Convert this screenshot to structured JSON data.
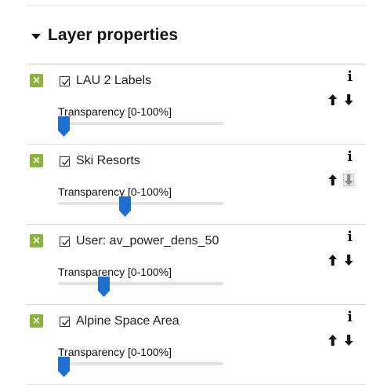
{
  "panel": {
    "title": "Layer properties",
    "collapse_icon": "caret-down-icon"
  },
  "layers": [
    {
      "name": "LAU 2 Labels",
      "visible": true,
      "transparency_label": "Transparency [0-100%]",
      "transparency": 0,
      "move_down_disabled": false
    },
    {
      "name": "Ski Resorts",
      "visible": true,
      "transparency_label": "Transparency [0-100%]",
      "transparency": 40,
      "move_down_disabled": true
    },
    {
      "name": "User: av_power_dens_50",
      "visible": true,
      "transparency_label": "Transparency [0-100%]",
      "transparency": 26,
      "move_down_disabled": false
    },
    {
      "name": "Alpine Space Area",
      "visible": true,
      "transparency_label": "Transparency [0-100%]",
      "transparency": 0,
      "move_down_disabled": false
    }
  ],
  "icons": {
    "remove": "close-icon",
    "remove_glyph": "×",
    "info": "info-icon",
    "info_glyph": "i",
    "up": "arrow-up-icon",
    "down": "arrow-down-icon"
  },
  "colors": {
    "remove_button": "#8cb33b",
    "slider_thumb": "#1e6fd0",
    "slider_track": "#e3e3e3"
  }
}
